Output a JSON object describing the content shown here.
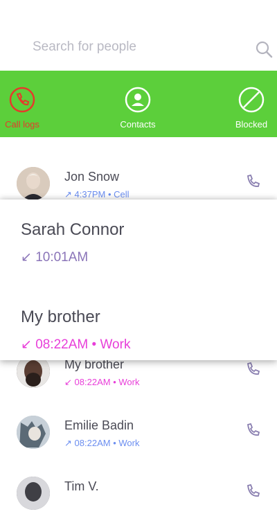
{
  "search": {
    "placeholder": "Search for people",
    "icon": "search-icon"
  },
  "tabs": [
    {
      "label": "Call logs",
      "icon": "phone-icon",
      "active": true,
      "color": "#e6392b"
    },
    {
      "label": "Contacts",
      "icon": "contact-icon",
      "active": false
    },
    {
      "label": "Blocked",
      "icon": "blocked-icon",
      "active": false
    }
  ],
  "colors": {
    "tabbar": "#5ccf3b",
    "active_tab": "#e6392b",
    "outgoing": "#6b8ef0",
    "incoming": "#8a74b8",
    "missed": "#e83ed9"
  },
  "call_logs": [
    {
      "name": "Jon Snow",
      "arrow": "↗",
      "time": "4:37PM",
      "separator": "•",
      "type": "Cell",
      "direction": "outgoing"
    },
    {
      "name": "My brother",
      "arrow": "↙",
      "time": "08:22AM",
      "separator": "•",
      "type": "Work",
      "direction": "missed"
    },
    {
      "name": "Emilie Badin",
      "arrow": "↗",
      "time": "08:22AM",
      "separator": "•",
      "type": "Work",
      "direction": "outgoing"
    },
    {
      "name": "Tim V.",
      "arrow": "",
      "time": "",
      "separator": "",
      "type": "",
      "direction": ""
    }
  ],
  "popup": [
    {
      "name": "Sarah Connor",
      "arrow": "↙",
      "time": "10:01AM",
      "direction": "incoming"
    },
    {
      "name": "My brother",
      "arrow": "↙",
      "time": "08:22AM",
      "separator": "•",
      "type": "Work",
      "direction": "missed"
    }
  ]
}
